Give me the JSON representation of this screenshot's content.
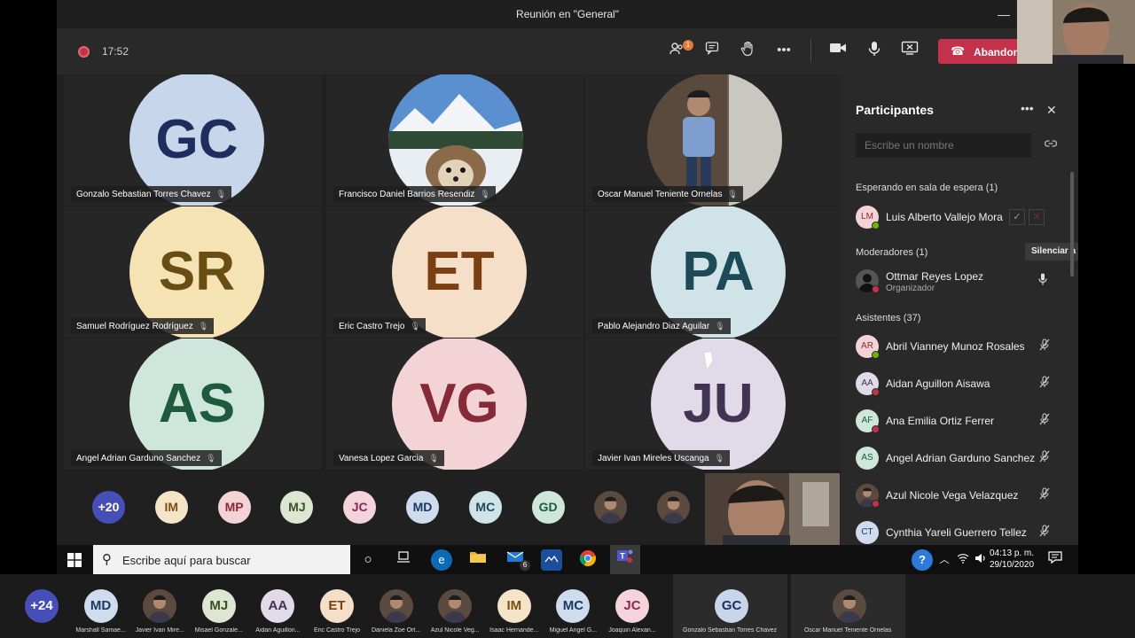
{
  "window": {
    "title": "Reunión en \"General\"",
    "minimize": "—",
    "restore": "❐",
    "close": "✕"
  },
  "toolbar": {
    "timer": "17:52",
    "participants_badge": "1",
    "leave_label": "Abandonar"
  },
  "grid": [
    {
      "name": "Gonzalo Sebastian Torres Chavez",
      "initials": "GC",
      "bg": "#c7d6ea",
      "fg": "#1d2e5e"
    },
    {
      "name": "Francisco Daniel Barrios Resendiz",
      "initials": "",
      "photo": "hedgehog"
    },
    {
      "name": "Oscar Manuel Teniente Ornelas",
      "initials": "",
      "photo": "person"
    },
    {
      "name": "Samuel Rodríguez Rodríguez",
      "initials": "SR",
      "bg": "#f5e3b4",
      "fg": "#6a4d12"
    },
    {
      "name": "Eric Castro Trejo",
      "initials": "ET",
      "bg": "#f6dfc8",
      "fg": "#7a4012"
    },
    {
      "name": "Pablo Alejandro Diaz Aguilar",
      "initials": "PA",
      "bg": "#cfe3e9",
      "fg": "#1e4a57"
    },
    {
      "name": "Angel Adrian Garduno Sanchez",
      "initials": "AS",
      "bg": "#cfe6dc",
      "fg": "#1e5a3c"
    },
    {
      "name": "Vanesa Lopez Garcia",
      "initials": "VG",
      "bg": "#f4d3d6",
      "fg": "#862a38"
    },
    {
      "name": "Javier Ivan Mireles Uscanga",
      "initials": "JU",
      "bg": "#e1dbe9",
      "fg": "#3f3452"
    }
  ],
  "strip": [
    {
      "label": "+20",
      "bg": "#464eb8",
      "fg": "#ffffff"
    },
    {
      "label": "IM",
      "bg": "#f6e4c8",
      "fg": "#7a4f12"
    },
    {
      "label": "MP",
      "bg": "#f4d3d6",
      "fg": "#862a38"
    },
    {
      "label": "MJ",
      "bg": "#dde5d3",
      "fg": "#3b4f2a"
    },
    {
      "label": "JC",
      "bg": "#f4d3dc",
      "fg": "#862a50"
    },
    {
      "label": "MD",
      "bg": "#cfdced",
      "fg": "#1d3760"
    },
    {
      "label": "MC",
      "bg": "#cfe3e9",
      "fg": "#1e4a57"
    },
    {
      "label": "GD",
      "bg": "#cfe6dc",
      "fg": "#1e5a3c"
    },
    {
      "label": "",
      "photo": true
    },
    {
      "label": "",
      "photo": true
    }
  ],
  "panel": {
    "title": "Participantes",
    "more": "•••",
    "close": "✕",
    "search_placeholder": "Escribe un nombre",
    "waiting_header": "Esperando en sala de espera (1)",
    "waiting": {
      "name": "Luis Alberto Vallejo Mora",
      "initials": "LM"
    },
    "moderators_header": "Moderadores (1)",
    "mute_all": "Silenciar a todos",
    "moderator": {
      "name": "Ottmar Reyes Lopez",
      "role": "Organizador"
    },
    "attendees_header": "Asistentes (37)",
    "attendees": [
      {
        "name": "Abril Vianney Munoz Rosales",
        "initials": "AR",
        "bg": "#f4d3d6",
        "fg": "#862a38",
        "dot": "#6bb700"
      },
      {
        "name": "Aidan Aguillon Aisawa",
        "initials": "AA",
        "bg": "#e1dbe9",
        "fg": "#3f3452",
        "dot": "#c4314b"
      },
      {
        "name": "Ana Emilia Ortiz Ferrer",
        "initials": "AF",
        "bg": "#cfe6dc",
        "fg": "#1e5a3c",
        "dot": "#c4314b"
      },
      {
        "name": "Angel Adrian Garduno Sanchez",
        "initials": "AS",
        "bg": "#cfe6dc",
        "fg": "#1e5a3c",
        "dot": ""
      },
      {
        "name": "Azul Nicole Vega Velazquez",
        "initials": "",
        "bg": "#6b5a4c",
        "fg": "#ffffff",
        "dot": "#c4314b"
      },
      {
        "name": "Cynthia Yareli Guerrero Tellez",
        "initials": "CT",
        "bg": "#cfdced",
        "fg": "#1d3760",
        "dot": ""
      }
    ]
  },
  "taskbar": {
    "search_placeholder": "Escribe aquí para buscar",
    "time": "04:13 p. m.",
    "date": "29/10/2020",
    "mail_badge": "6"
  },
  "outer_strip": [
    {
      "label": "+24",
      "caption": "",
      "bg": "#464eb8",
      "fg": "#ffffff"
    },
    {
      "label": "MD",
      "caption": "Marshall Samae...",
      "bg": "#cfdced",
      "fg": "#1d3760"
    },
    {
      "label": "",
      "caption": "Javier Ivan Mire...",
      "photo": true
    },
    {
      "label": "MJ",
      "caption": "Misael Gonzale...",
      "bg": "#dde5d3",
      "fg": "#3b4f2a"
    },
    {
      "label": "AA",
      "caption": "Aidan Aguillon...",
      "bg": "#e1dbe9",
      "fg": "#3f3452"
    },
    {
      "label": "ET",
      "caption": "Eric Castro Trejo",
      "bg": "#f6dfc8",
      "fg": "#7a4012"
    },
    {
      "label": "",
      "caption": "Daniela Zoe Ort...",
      "photo": true
    },
    {
      "label": "",
      "caption": "Azul Nicole Veg...",
      "photo": true
    },
    {
      "label": "IM",
      "caption": "Isaac Hernande...",
      "bg": "#f6e4c8",
      "fg": "#7a4f12"
    },
    {
      "label": "MC",
      "caption": "Miguel Angel G...",
      "bg": "#cfdced",
      "fg": "#1d3760"
    },
    {
      "label": "JC",
      "caption": "Joaquin Alexan...",
      "bg": "#f4d3dc",
      "fg": "#862a50"
    },
    {
      "label": "GC",
      "caption": "Gonzalo Sebastian Torres Chavez",
      "bg": "#c7d6ea",
      "fg": "#1d2e5e",
      "wide": true
    },
    {
      "label": "",
      "caption": "Oscar Manuel Teniente Ornelas",
      "photo": true,
      "wide": true
    }
  ]
}
